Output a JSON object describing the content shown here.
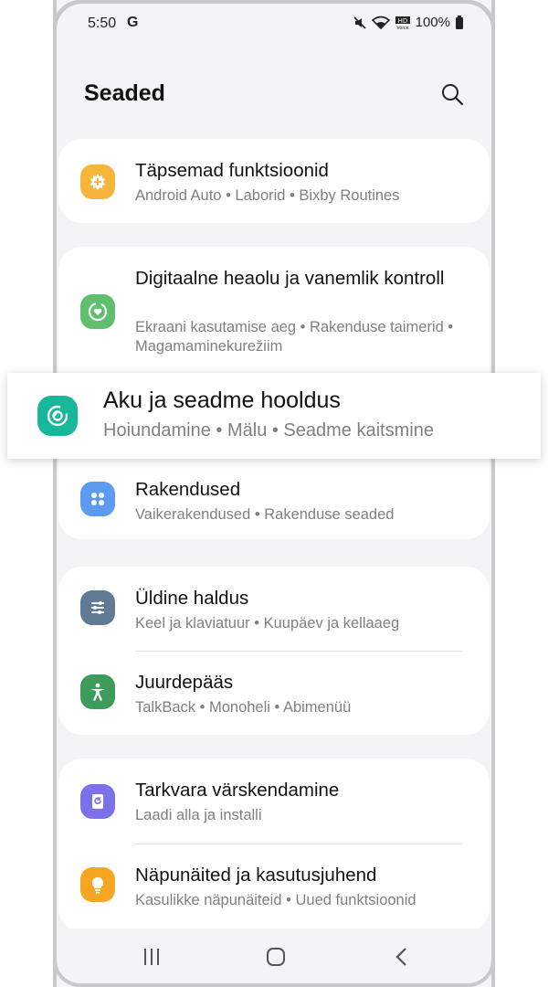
{
  "status_bar": {
    "time": "5:50",
    "carrier_glyph": "G",
    "battery": "100%",
    "icons": [
      "mute-icon",
      "wifi-icon",
      "hd-voice-icon",
      "battery-icon"
    ]
  },
  "header": {
    "title": "Seaded",
    "search_icon": "search-icon"
  },
  "sections": {
    "advanced": {
      "title": "Täpsemad funktsioonid",
      "subtitle": "Android Auto  •  Laborid  •  Bixby Routines",
      "icon": "plus-gear-icon",
      "color": "#f7b53b"
    },
    "wellbeing": {
      "title": "Digitaalne heaolu ja vanemlik kontroll",
      "subtitle": "Ekraani kasutamise aeg  •  Rakenduse taimerid  •  Magamaminekurežiim",
      "icon": "heart-circle-icon",
      "color": "#5fbf6e"
    },
    "battery": {
      "title": "Aku ja seadme hooldus",
      "subtitle": "Hoiundamine  •  Mälu  •  Seadme kaitsmine",
      "icon": "device-care-icon",
      "color": "#17b89a"
    },
    "apps": {
      "title": "Rakendused",
      "subtitle": "Vaikerakendused  •  Rakenduse seaded",
      "icon": "apps-grid-icon",
      "color": "#5b9cf2"
    },
    "general": {
      "title": "Üldine haldus",
      "subtitle": "Keel ja klaviatuur  •  Kuupäev ja kellaaeg",
      "icon": "sliders-icon",
      "color": "#5f7a92"
    },
    "accessibility": {
      "title": "Juurdepääs",
      "subtitle": "TalkBack  •  Monoheli  •  Abimenüü",
      "icon": "accessibility-person-icon",
      "color": "#3d9c5c"
    },
    "software": {
      "title": "Tarkvara värskendamine",
      "subtitle": "Laadi alla ja installi",
      "icon": "software-update-icon",
      "color": "#7b71e8"
    },
    "tips": {
      "title": "Näpunäited ja kasutusjuhend",
      "subtitle": "Kasulikke näpunäiteid  •  Uued funktsioonid",
      "icon": "lightbulb-icon",
      "color": "#f5a623"
    }
  },
  "nav_bar": {
    "buttons": [
      "recents-icon",
      "home-icon",
      "back-icon"
    ]
  }
}
